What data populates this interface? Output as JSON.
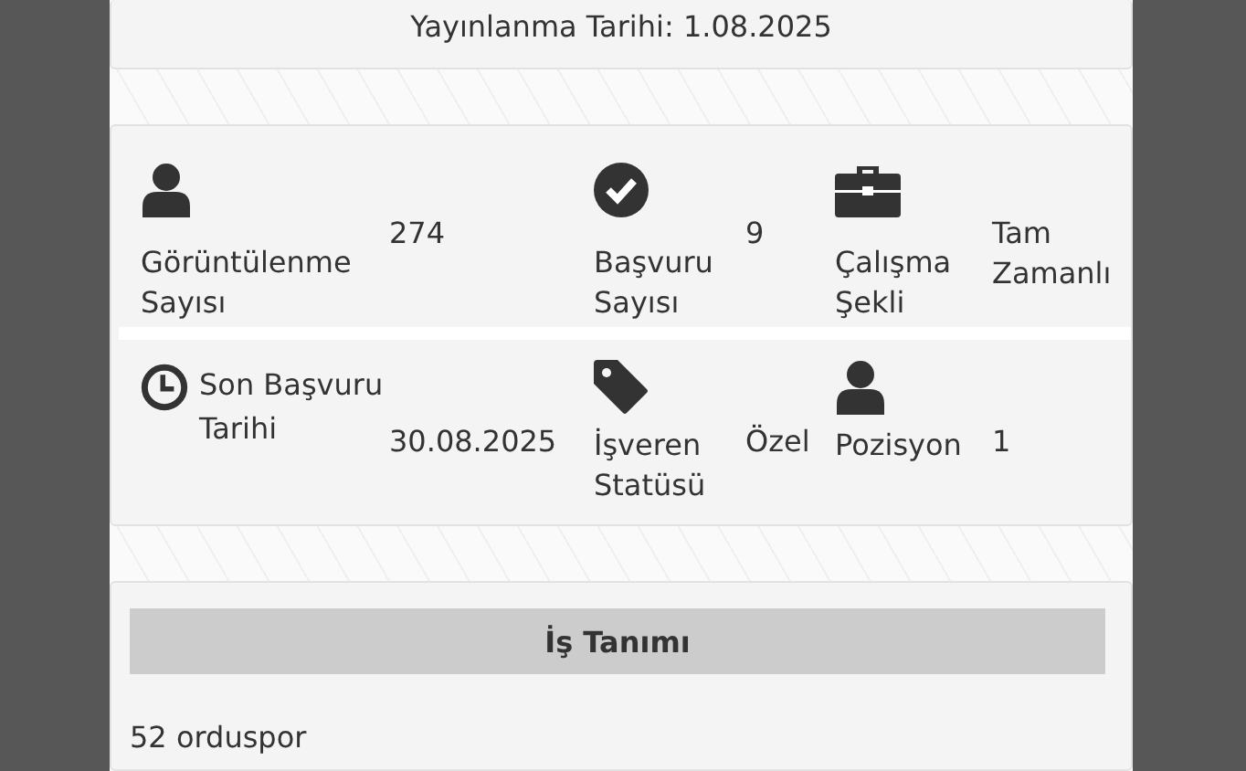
{
  "header": {
    "publish_date": "Yayınlanma Tarihi: 1.08.2025"
  },
  "stat_rows": [
    [
      {
        "kind": "person",
        "label": "Görüntülenme Sayısı",
        "value": "274"
      },
      {
        "kind": "check",
        "label": "Başvuru Sayısı",
        "value": "9"
      },
      {
        "kind": "briefcase",
        "label": "Çalışma Şekli",
        "value": "Tam Zamanlı"
      }
    ],
    [
      {
        "kind": "clock",
        "label": "Son Başvuru Tarihi",
        "value": "30.08.2025"
      },
      {
        "kind": "tag",
        "label": "İşveren Statüsü",
        "value": "Özel"
      },
      {
        "kind": "person",
        "label": "Pozisyon",
        "value": "1"
      }
    ]
  ],
  "description": {
    "title": "İş Tanımı",
    "text": "52 orduspor"
  }
}
